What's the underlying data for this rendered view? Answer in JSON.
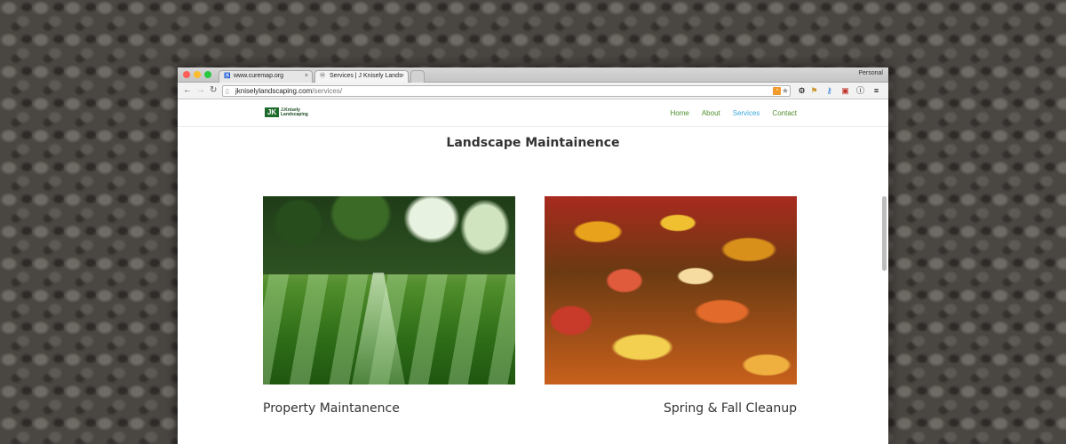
{
  "browser": {
    "tabs": [
      {
        "label": "www.curemap.org",
        "close": "×"
      },
      {
        "label": "Services | J Knisely Lands",
        "close": "×"
      }
    ],
    "profile": "Personal",
    "url": {
      "host": "jkniselylandscaping.com",
      "path": "/services/"
    }
  },
  "site": {
    "logo": {
      "mark": "JK",
      "text": "J.Knisely Landscaping"
    },
    "nav": [
      {
        "label": "Home"
      },
      {
        "label": "About"
      },
      {
        "label": "Services"
      },
      {
        "label": "Contact"
      }
    ]
  },
  "main": {
    "section_title": "Landscape Maintainence",
    "cards": [
      {
        "caption": "Property Maintanence"
      },
      {
        "caption": "Spring & Fall Cleanup"
      }
    ]
  },
  "colors": {
    "nav_link": "#4d8f2e",
    "nav_active": "#3aa6d8",
    "logo_green": "#1e6b2c"
  }
}
